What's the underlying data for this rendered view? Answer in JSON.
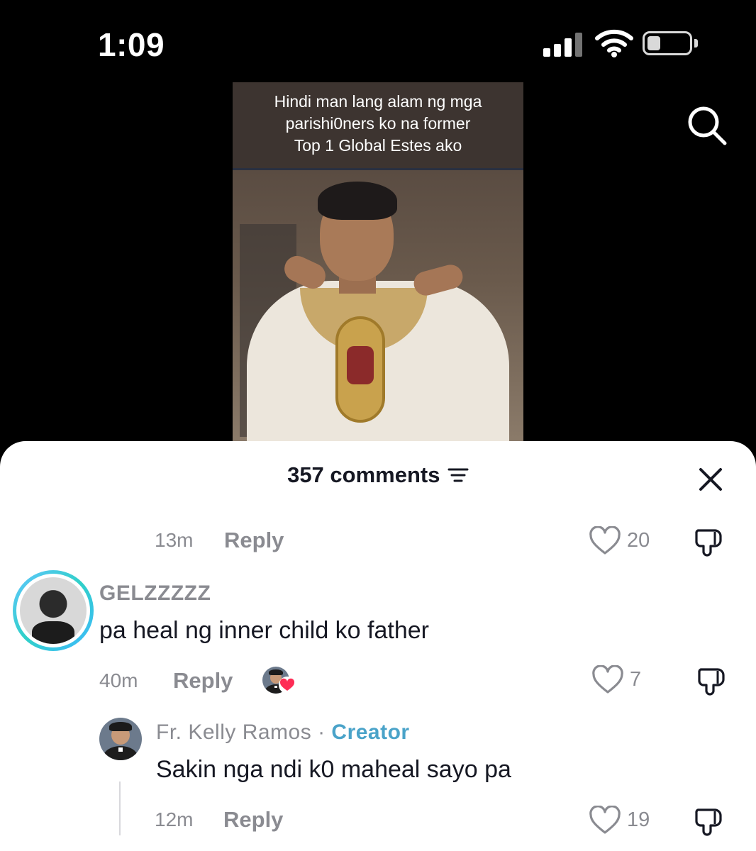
{
  "status_bar": {
    "time": "1:09"
  },
  "video": {
    "caption_lines": [
      "Hindi man lang alam ng mga",
      "parishi0ners ko na former",
      "Top 1 Global Estes ako"
    ]
  },
  "icons": {
    "search": "search-icon",
    "close": "close-icon",
    "sort": "sort-filter-icon",
    "like": "heart-outline-icon",
    "dislike": "thumbs-down-icon"
  },
  "comments_panel": {
    "count_label": "357 comments"
  },
  "comments": [
    {
      "time": "13m",
      "reply_label": "Reply",
      "likes": "20"
    },
    {
      "username": "GELZZZZZ",
      "text": "pa heal ng inner child ko father",
      "time": "40m",
      "reply_label": "Reply",
      "likes": "7",
      "liked_by_creator": true
    },
    {
      "username": "Fr. Kelly Ramos",
      "separator": "·",
      "badge": "Creator",
      "text": "Sakin nga ndi k0 maheal sayo pa",
      "time": "12m",
      "reply_label": "Reply",
      "likes": "19"
    }
  ],
  "colors": {
    "accent_creator": "#4aa3c9",
    "muted_text": "#8a8b91",
    "primary_text": "#161823",
    "like_heart": "#fe2c55"
  }
}
